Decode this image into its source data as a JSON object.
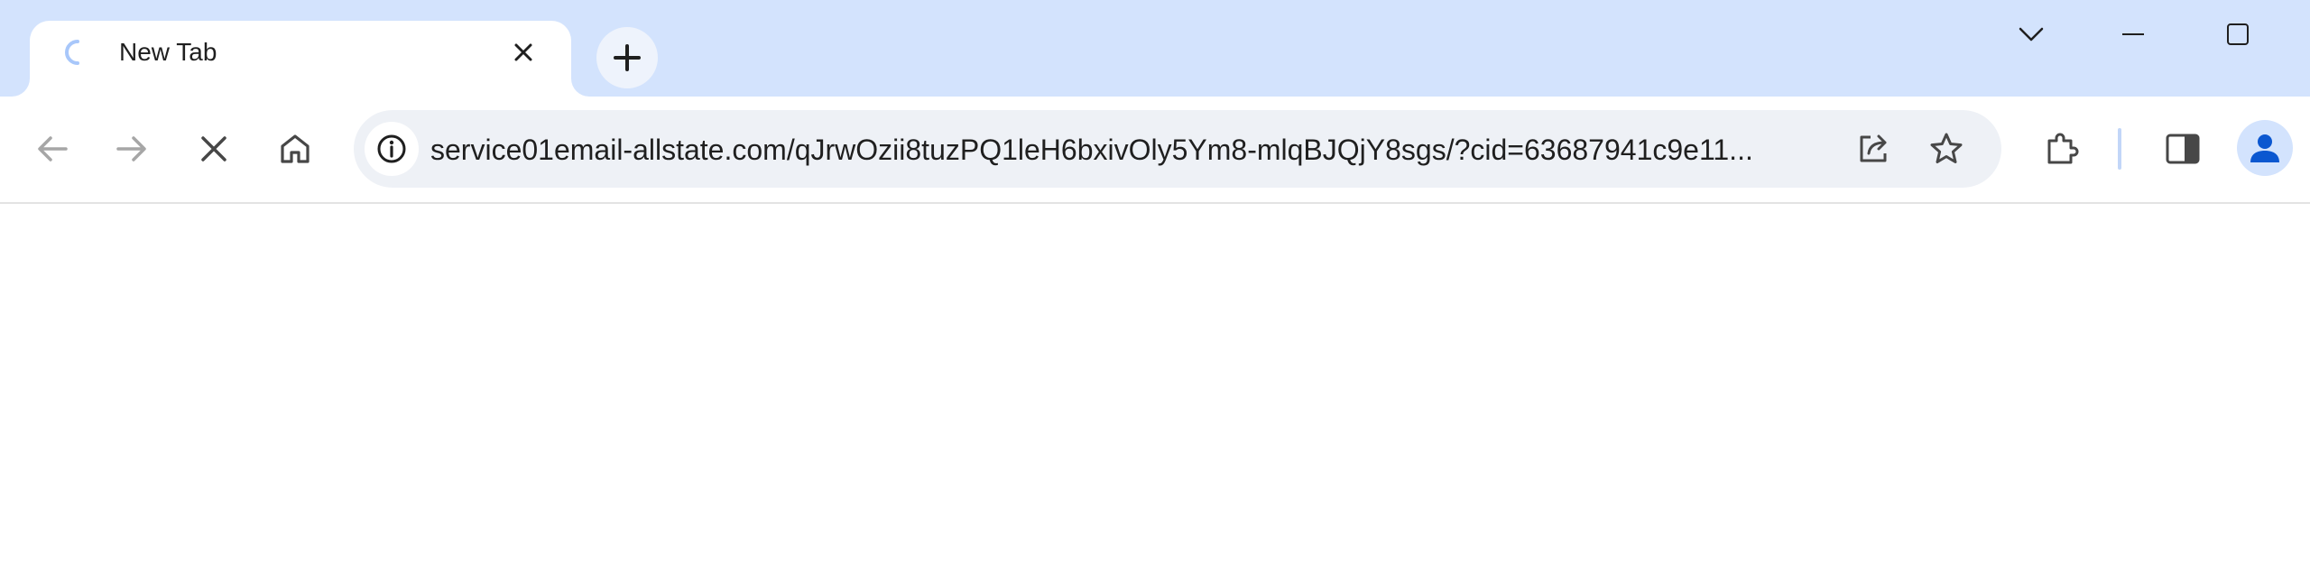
{
  "tab": {
    "title": "New Tab",
    "loading": true,
    "icons": {
      "spinner": "loading-spinner-icon",
      "close": "close-icon"
    }
  },
  "tabstrip": {
    "new_tab_icon": "plus-icon",
    "window_controls": [
      "tab-search-icon",
      "minimize-icon",
      "maximize-icon"
    ]
  },
  "toolbar": {
    "back_icon": "arrow-left-icon",
    "forward_icon": "arrow-right-icon",
    "stop_icon": "close-icon",
    "home_icon": "home-icon",
    "extensions_icon": "puzzle-icon",
    "side_panel_icon": "side-panel-icon",
    "profile_icon": "profile-avatar-icon"
  },
  "omnibox": {
    "url": "service01email-allstate.com/qJrwOzii8tuzPQ1leH6bxivOly5Ym8-mlqBJQjY8sgs/?cid=63687941c9e11...",
    "site_info_icon": "info-icon",
    "share_icon": "share-icon",
    "bookmark_icon": "star-icon"
  },
  "colors": {
    "tabstrip_bg": "#d3e3fd",
    "omnibox_bg": "#eef1f6",
    "icon": "#474747",
    "accent": "#0b57d0"
  }
}
